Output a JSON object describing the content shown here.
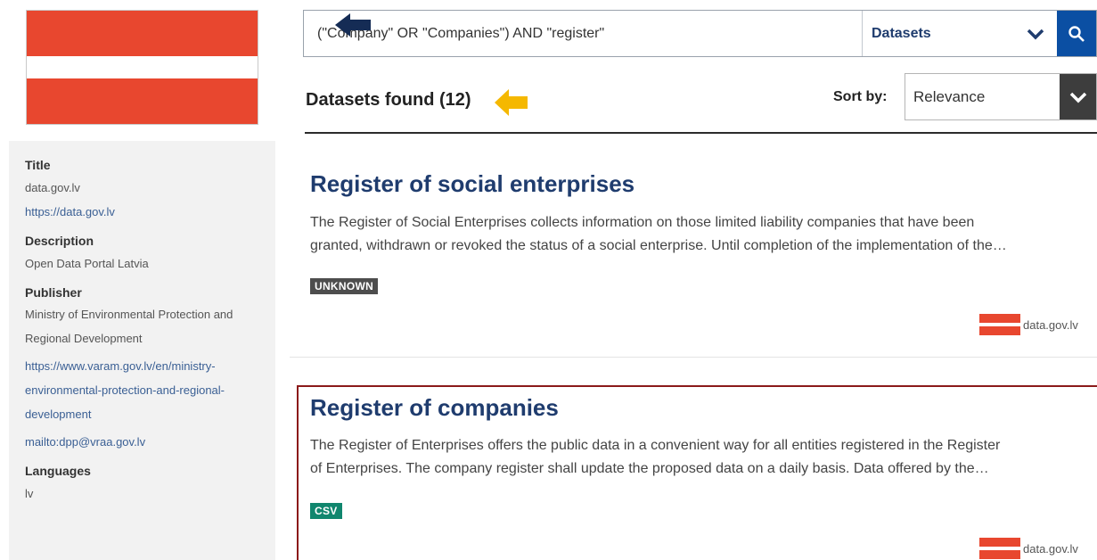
{
  "sidebar": {
    "title_label": "Title",
    "title_value": "data.gov.lv",
    "title_url": "https://data.gov.lv",
    "description_label": "Description",
    "description_value": "Open Data Portal Latvia",
    "publisher_label": "Publisher",
    "publisher_line1": "Ministry of Environmental Protection and",
    "publisher_line2": "Regional Development",
    "publisher_url_line1": "https://www.varam.gov.lv/en/ministry-",
    "publisher_url_line2": "environmental-protection-and-regional-",
    "publisher_url_line3": "development",
    "publisher_mail": "mailto:dpp@vraa.gov.lv",
    "languages_label": "Languages",
    "languages_value": "lv"
  },
  "search": {
    "query": "(\"Company\" OR \"Companies\") AND \"register\"",
    "scope": "Datasets"
  },
  "results": {
    "found_label": "Datasets found (12)",
    "sort_label": "Sort by:",
    "sort_value": "Relevance",
    "items": [
      {
        "title": "Register of social enterprises",
        "desc_line1": "The Register of Social Enterprises collects information on those limited liability companies that have been",
        "desc_line2": "granted, withdrawn or revoked the status of a social enterprise. Until completion of the implementation of the…",
        "format": "UNKNOWN",
        "publisher": "data.gov.lv"
      },
      {
        "title": "Register of companies",
        "desc_line1": "The Register of Enterprises offers the public data in a convenient way for all entities registered in the Register",
        "desc_line2": "of Enterprises. The company register shall update the proposed data on a daily basis. Data offered by the…",
        "format": "CSV",
        "publisher": "data.gov.lv"
      }
    ]
  },
  "colors": {
    "flag_red": "#e8472f",
    "navy": "#1f3c6e",
    "search_button": "#0b4fa3",
    "highlight_border": "#8b1a1a",
    "csv_badge": "#10866e",
    "unknown_badge": "#4d4d4d",
    "arrow_yellow": "#f5b800"
  },
  "icons": {
    "search": "search-icon",
    "chevron": "chevron-down-icon",
    "arrow": "arrow-left-icon"
  }
}
